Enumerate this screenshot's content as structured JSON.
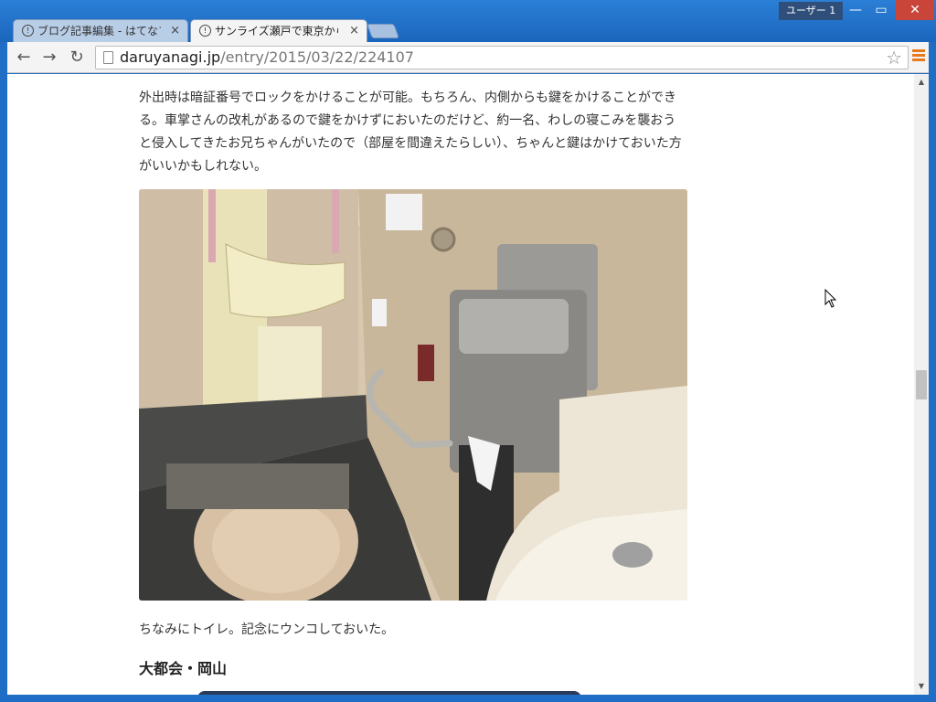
{
  "window": {
    "user_badge": "ユーザー 1",
    "minimize": "—",
    "maximize": "▭",
    "close": "✕"
  },
  "tabs": [
    {
      "label": "ブログ記事編集 - はてなブロ",
      "active": false
    },
    {
      "label": "サンライズ瀬戸で東京から松山",
      "active": true
    }
  ],
  "toolbar": {
    "back": "←",
    "forward": "→",
    "reload": "↻",
    "url_host": "daruyanagi.jp",
    "url_path": "/entry/2015/03/22/224107",
    "bookmark": "☆"
  },
  "article": {
    "paragraph1": "外出時は暗証番号でロックをかけることが可能。もちろん、内側からも鍵をかけることができる。車掌さんの改札があるので鍵をかけずにおいたのだけど、約一名、わしの寝こみを襲おうと侵入してきたお兄ちゃんがいたので（部屋を間違えたらしい）、ちゃんと鍵はかけておいた方がいいかもしれない。",
    "caption": "ちなみにトイレ。記念にウンコしておいた。",
    "heading": "大都会・岡山"
  },
  "colors": {
    "titlebar": "#1f6dc4",
    "close_button": "#c9453a",
    "menu_accent": "#e87a1e"
  }
}
